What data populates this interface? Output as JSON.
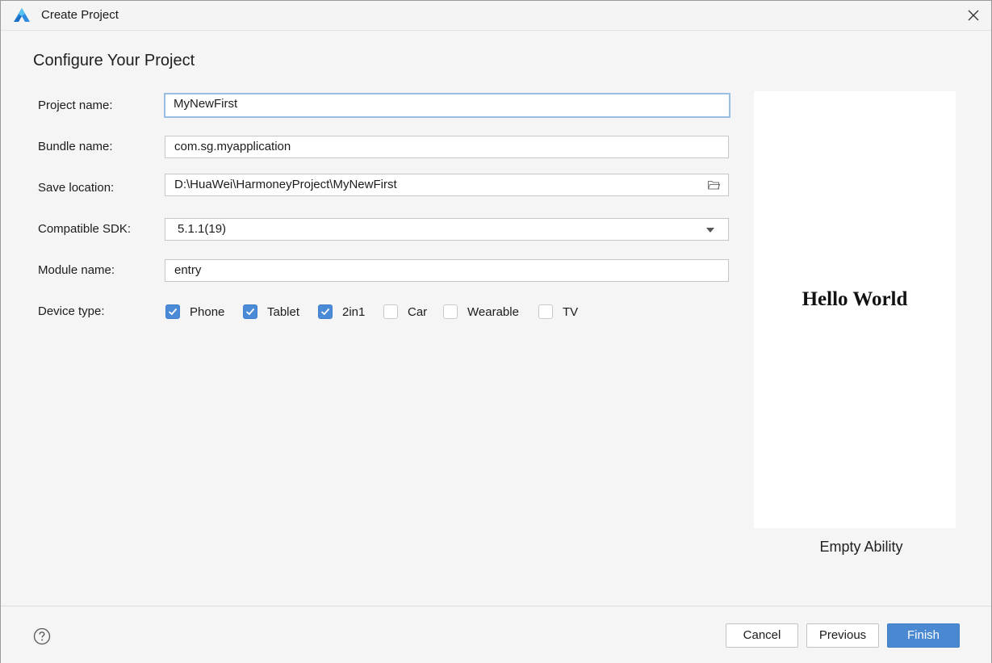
{
  "window": {
    "title": "Create Project"
  },
  "page": {
    "heading": "Configure Your Project"
  },
  "form": {
    "project_name": {
      "label": "Project name:",
      "value": "MyNewFirst"
    },
    "bundle_name": {
      "label": "Bundle name:",
      "value": "com.sg.myapplication"
    },
    "save_location": {
      "label": "Save location:",
      "value": "D:\\HuaWei\\HarmoneyProject\\MyNewFirst",
      "icon": "folder-icon"
    },
    "compatible_sdk": {
      "label": "Compatible SDK:",
      "value": "5.1.1(19)"
    },
    "module_name": {
      "label": "Module name:",
      "value": "entry"
    },
    "device_type": {
      "label": "Device type:",
      "options": [
        {
          "label": "Phone",
          "checked": true
        },
        {
          "label": "Tablet",
          "checked": true
        },
        {
          "label": "2in1",
          "checked": true
        },
        {
          "label": "Car",
          "checked": false
        },
        {
          "label": "Wearable",
          "checked": false
        },
        {
          "label": "TV",
          "checked": false
        }
      ]
    }
  },
  "preview": {
    "text": "Hello World",
    "template_name": "Empty Ability"
  },
  "footer": {
    "help_icon": "help-icon",
    "cancel_label": "Cancel",
    "previous_label": "Previous",
    "finish_label": "Finish"
  },
  "colors": {
    "accent": "#4a89d2",
    "focus_border": "#9bbde3"
  }
}
